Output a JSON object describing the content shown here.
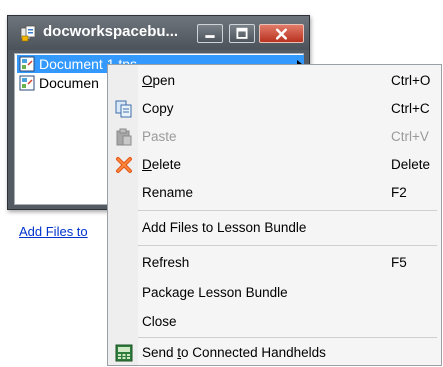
{
  "window": {
    "title": "docworkspacebu...",
    "icon": "app-icon",
    "controls": [
      "minimize-icon",
      "maximize-icon",
      "close-icon"
    ]
  },
  "files": [
    {
      "name": "Document 1.tns",
      "selected": true,
      "icon": "document-icon"
    },
    {
      "name": "Documen",
      "selected": false,
      "icon": "document-icon"
    }
  ],
  "link": {
    "label": "Add Files to"
  },
  "menu": {
    "items": [
      {
        "label": "Open",
        "shortcut": "Ctrl+O",
        "icon": "",
        "mnemonic": "O",
        "rest": "pen",
        "disabled": false
      },
      {
        "label": "Copy",
        "shortcut": "Ctrl+C",
        "icon": "copy-icon",
        "mnemonic": "",
        "rest": "Copy",
        "disabled": false
      },
      {
        "label": "Paste",
        "shortcut": "Ctrl+V",
        "icon": "paste-icon",
        "mnemonic": "",
        "rest": "Paste",
        "disabled": true
      },
      {
        "label": "Delete",
        "shortcut": "Delete",
        "icon": "delete-icon",
        "mnemonic": "D",
        "rest": "elete",
        "disabled": false
      },
      {
        "label": "Rename",
        "shortcut": "F2",
        "icon": "",
        "mnemonic": "",
        "rest": "Rename",
        "disabled": false
      },
      {
        "label": "Add Files to Lesson Bundle",
        "shortcut": "",
        "icon": "",
        "mnemonic": "",
        "rest": "Add Files to Lesson Bundle",
        "disabled": false
      },
      {
        "label": "Refresh",
        "shortcut": "F5",
        "icon": "",
        "mnemonic": "",
        "rest": "Refresh",
        "disabled": false
      },
      {
        "label": "Package Lesson Bundle",
        "shortcut": "",
        "icon": "",
        "mnemonic": "",
        "rest": "Package Lesson Bundle",
        "disabled": false
      },
      {
        "label": "Close",
        "shortcut": "",
        "icon": "",
        "mnemonic": "",
        "rest": "Close",
        "disabled": false
      },
      {
        "label": "Send to Connected Handhelds",
        "shortcut": "",
        "icon": "send-handheld-icon",
        "pre": "Send ",
        "mnemonic": "t",
        "rest": "o Connected Handhelds",
        "disabled": false
      }
    ]
  },
  "colors": {
    "selection": "#3399ff",
    "close_button": "#c8412d",
    "link": "#0033cc",
    "disabled_text": "#9a9a9a"
  }
}
